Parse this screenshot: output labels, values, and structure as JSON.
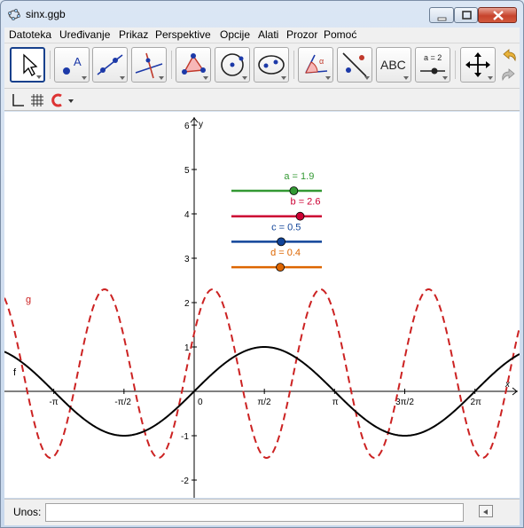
{
  "window": {
    "title": "sinx.ggb"
  },
  "menu": [
    "Datoteka",
    "Uređivanje",
    "Prikaz",
    "Perspektive",
    "Opcije",
    "Alati",
    "Prozor",
    "Pomoć"
  ],
  "toolbar": {
    "tools": [
      {
        "name": "move-tool",
        "icon": "arrow-pointer-icon"
      },
      {
        "name": "point-tool",
        "icon": "point-icon"
      },
      {
        "name": "line-tool",
        "icon": "line-icon"
      },
      {
        "name": "perpendicular-tool",
        "icon": "perpendicular-icon"
      },
      {
        "name": "polygon-tool",
        "icon": "polygon-icon"
      },
      {
        "name": "circle-tool",
        "icon": "circle-icon"
      },
      {
        "name": "ellipse-tool",
        "icon": "ellipse-icon"
      },
      {
        "name": "angle-tool",
        "icon": "angle-icon"
      },
      {
        "name": "reflect-tool",
        "icon": "reflect-icon"
      },
      {
        "name": "text-tool",
        "icon": "text-icon"
      },
      {
        "name": "slider-tool",
        "icon": "slider-icon"
      },
      {
        "name": "move-graphics-tool",
        "icon": "move-arrows-icon"
      }
    ],
    "text_tool_label": "ABC",
    "slider_tool_label": "a = 2"
  },
  "graphics": {
    "y_axis_label": "y",
    "x_axis_label": "x",
    "x_ticks": [
      "-π",
      "-π/2",
      "0",
      "π/2",
      "π",
      "3π/2",
      "2π"
    ],
    "y_ticks": [
      "6",
      "5",
      "4",
      "3",
      "2",
      "1",
      "-1",
      "-2"
    ],
    "functions": [
      {
        "name": "f",
        "label": "f",
        "expression": "sin(x)",
        "color": "#000000",
        "style": "solid"
      },
      {
        "name": "g",
        "label": "g",
        "expression": "a·sin(b·x + c) + d",
        "color": "#cc2222",
        "style": "dashed"
      }
    ],
    "sliders": [
      {
        "name": "a",
        "label": "a = 1.9",
        "value": 1.9,
        "color": "#339933"
      },
      {
        "name": "b",
        "label": "b = 2.6",
        "value": 2.6,
        "color": "#cc0033"
      },
      {
        "name": "c",
        "label": "c = 0.5",
        "value": 0.5,
        "color": "#114499"
      },
      {
        "name": "d",
        "label": "d = 0.4",
        "value": 0.4,
        "color": "#dd6600"
      }
    ]
  },
  "input_bar": {
    "label": "Unos:",
    "value": ""
  }
}
